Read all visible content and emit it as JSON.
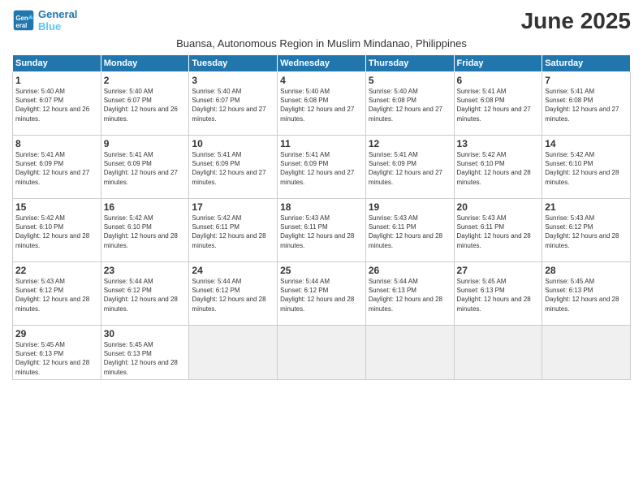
{
  "logo": {
    "line1": "General",
    "line2": "Blue"
  },
  "title": "June 2025",
  "subtitle": "Buansa, Autonomous Region in Muslim Mindanao, Philippines",
  "days_of_week": [
    "Sunday",
    "Monday",
    "Tuesday",
    "Wednesday",
    "Thursday",
    "Friday",
    "Saturday"
  ],
  "weeks": [
    [
      {
        "day": "1",
        "sunrise": "5:40 AM",
        "sunset": "6:07 PM",
        "daylight": "12 hours and 26 minutes."
      },
      {
        "day": "2",
        "sunrise": "5:40 AM",
        "sunset": "6:07 PM",
        "daylight": "12 hours and 26 minutes."
      },
      {
        "day": "3",
        "sunrise": "5:40 AM",
        "sunset": "6:07 PM",
        "daylight": "12 hours and 27 minutes."
      },
      {
        "day": "4",
        "sunrise": "5:40 AM",
        "sunset": "6:08 PM",
        "daylight": "12 hours and 27 minutes."
      },
      {
        "day": "5",
        "sunrise": "5:40 AM",
        "sunset": "6:08 PM",
        "daylight": "12 hours and 27 minutes."
      },
      {
        "day": "6",
        "sunrise": "5:41 AM",
        "sunset": "6:08 PM",
        "daylight": "12 hours and 27 minutes."
      },
      {
        "day": "7",
        "sunrise": "5:41 AM",
        "sunset": "6:08 PM",
        "daylight": "12 hours and 27 minutes."
      }
    ],
    [
      {
        "day": "8",
        "sunrise": "5:41 AM",
        "sunset": "6:09 PM",
        "daylight": "12 hours and 27 minutes."
      },
      {
        "day": "9",
        "sunrise": "5:41 AM",
        "sunset": "6:09 PM",
        "daylight": "12 hours and 27 minutes."
      },
      {
        "day": "10",
        "sunrise": "5:41 AM",
        "sunset": "6:09 PM",
        "daylight": "12 hours and 27 minutes."
      },
      {
        "day": "11",
        "sunrise": "5:41 AM",
        "sunset": "6:09 PM",
        "daylight": "12 hours and 27 minutes."
      },
      {
        "day": "12",
        "sunrise": "5:41 AM",
        "sunset": "6:09 PM",
        "daylight": "12 hours and 27 minutes."
      },
      {
        "day": "13",
        "sunrise": "5:42 AM",
        "sunset": "6:10 PM",
        "daylight": "12 hours and 28 minutes."
      },
      {
        "day": "14",
        "sunrise": "5:42 AM",
        "sunset": "6:10 PM",
        "daylight": "12 hours and 28 minutes."
      }
    ],
    [
      {
        "day": "15",
        "sunrise": "5:42 AM",
        "sunset": "6:10 PM",
        "daylight": "12 hours and 28 minutes."
      },
      {
        "day": "16",
        "sunrise": "5:42 AM",
        "sunset": "6:10 PM",
        "daylight": "12 hours and 28 minutes."
      },
      {
        "day": "17",
        "sunrise": "5:42 AM",
        "sunset": "6:11 PM",
        "daylight": "12 hours and 28 minutes."
      },
      {
        "day": "18",
        "sunrise": "5:43 AM",
        "sunset": "6:11 PM",
        "daylight": "12 hours and 28 minutes."
      },
      {
        "day": "19",
        "sunrise": "5:43 AM",
        "sunset": "6:11 PM",
        "daylight": "12 hours and 28 minutes."
      },
      {
        "day": "20",
        "sunrise": "5:43 AM",
        "sunset": "6:11 PM",
        "daylight": "12 hours and 28 minutes."
      },
      {
        "day": "21",
        "sunrise": "5:43 AM",
        "sunset": "6:12 PM",
        "daylight": "12 hours and 28 minutes."
      }
    ],
    [
      {
        "day": "22",
        "sunrise": "5:43 AM",
        "sunset": "6:12 PM",
        "daylight": "12 hours and 28 minutes."
      },
      {
        "day": "23",
        "sunrise": "5:44 AM",
        "sunset": "6:12 PM",
        "daylight": "12 hours and 28 minutes."
      },
      {
        "day": "24",
        "sunrise": "5:44 AM",
        "sunset": "6:12 PM",
        "daylight": "12 hours and 28 minutes."
      },
      {
        "day": "25",
        "sunrise": "5:44 AM",
        "sunset": "6:12 PM",
        "daylight": "12 hours and 28 minutes."
      },
      {
        "day": "26",
        "sunrise": "5:44 AM",
        "sunset": "6:13 PM",
        "daylight": "12 hours and 28 minutes."
      },
      {
        "day": "27",
        "sunrise": "5:45 AM",
        "sunset": "6:13 PM",
        "daylight": "12 hours and 28 minutes."
      },
      {
        "day": "28",
        "sunrise": "5:45 AM",
        "sunset": "6:13 PM",
        "daylight": "12 hours and 28 minutes."
      }
    ],
    [
      {
        "day": "29",
        "sunrise": "5:45 AM",
        "sunset": "6:13 PM",
        "daylight": "12 hours and 28 minutes."
      },
      {
        "day": "30",
        "sunrise": "5:45 AM",
        "sunset": "6:13 PM",
        "daylight": "12 hours and 28 minutes."
      },
      null,
      null,
      null,
      null,
      null
    ]
  ]
}
